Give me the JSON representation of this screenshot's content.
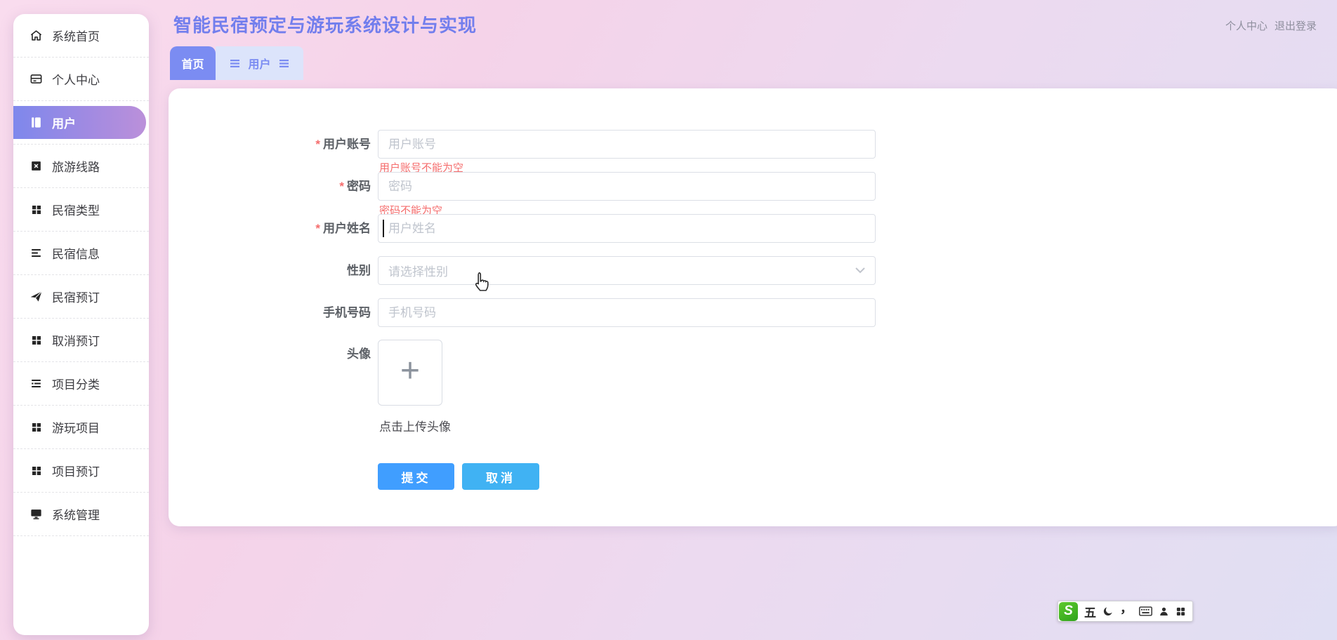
{
  "app": {
    "title": "智能民宿预定与游玩系统设计与实现"
  },
  "topbar": {
    "profile": "个人中心",
    "logout": "退出登录"
  },
  "sidebar": {
    "items": [
      {
        "label": "系统首页",
        "icon": "home"
      },
      {
        "label": "个人中心",
        "icon": "id-card"
      },
      {
        "label": "用户",
        "icon": "notebook",
        "active": true
      },
      {
        "label": "旅游线路",
        "icon": "clipboard-x"
      },
      {
        "label": "民宿类型",
        "icon": "grid"
      },
      {
        "label": "民宿信息",
        "icon": "list-lines"
      },
      {
        "label": "民宿预订",
        "icon": "paper-plane"
      },
      {
        "label": "取消预订",
        "icon": "grid"
      },
      {
        "label": "项目分类",
        "icon": "operation-lines"
      },
      {
        "label": "游玩项目",
        "icon": "grid"
      },
      {
        "label": "项目预订",
        "icon": "grid"
      },
      {
        "label": "系统管理",
        "icon": "monitor"
      }
    ]
  },
  "tabs": {
    "home": "首页",
    "user": "用户"
  },
  "form": {
    "required_mark": "*",
    "fields": [
      {
        "label": "用户账号",
        "placeholder": "用户账号",
        "required": true,
        "error": "用户账号不能为空"
      },
      {
        "label": "密码",
        "placeholder": "密码",
        "required": true,
        "error": "密码不能为空"
      },
      {
        "label": "用户姓名",
        "placeholder": "用户姓名",
        "required": true
      },
      {
        "label": "性别",
        "placeholder": "请选择性别",
        "required": false,
        "type": "select"
      },
      {
        "label": "手机号码",
        "placeholder": "手机号码",
        "required": false
      }
    ],
    "avatar": {
      "label": "头像",
      "plus": "+",
      "hint": "点击上传头像"
    },
    "buttons": {
      "submit": "提交",
      "cancel": "取消"
    }
  },
  "ime": {
    "logo": "S",
    "mode": "五",
    "punct": "，"
  },
  "colors": {
    "accent": "#7b8cf2",
    "title": "#727eed",
    "active_gradient": [
      "#7e88ec",
      "#bb90da"
    ],
    "tab_bg": "#dce4fb",
    "submit": "#409eff",
    "cancel": "#40b2f3",
    "error": "#f56c6c",
    "bg_gradient": [
      "#f9dcee",
      "#e0dff3"
    ]
  }
}
